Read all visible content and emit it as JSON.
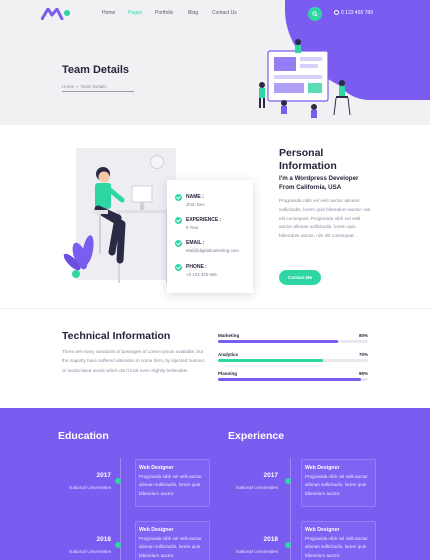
{
  "colors": {
    "accent": "#7a5cf0",
    "green": "#2ed6a4",
    "dark": "#23253a"
  },
  "nav": {
    "items": [
      "Home",
      "Pages",
      "Portfolio",
      "Blog",
      "Contact Us"
    ],
    "active": "Pages"
  },
  "header": {
    "phone": "0 123 456 789",
    "search_icon": "search-icon",
    "logo_icon": "logo-icon"
  },
  "hero": {
    "title": "Team Details",
    "breadcrumb": {
      "home": "Home",
      "current": "Team Details"
    }
  },
  "personal": {
    "title_line1": "Personal",
    "title_line2": "Information",
    "subtitle_line1": "I'm a Wordpress Developer",
    "subtitle_line2": "From California, USA",
    "text": "Progravida nibh vel velit auctor alinean sollicitudin, lorem quis bibendum auctor. nisi elit consequat. Progravida nibh vel velit auctor alinean sollicitudin, lorem quis bibendum auctor, nisi elit consequat.",
    "button": "Contact Me",
    "card": [
      {
        "label": "NAME :",
        "value": "Jhon Deo"
      },
      {
        "label": "EXPERIENCE :",
        "value": "8 Year"
      },
      {
        "label": "EMAIL :",
        "value": "Mail@digitalmarketing.com"
      },
      {
        "label": "PHONE :",
        "value": "+0 123 345 666"
      }
    ]
  },
  "technical": {
    "title": "Technical Information",
    "text": "There are many variations of passages of Lorem Ipsum available, but the majority have suffered alteration in some form, by injected humour, or randomised words which don't look even slightly believable.",
    "skills": [
      {
        "name": "Marketing",
        "percent": "80%",
        "value": 0.8,
        "color": "#7a5cf0"
      },
      {
        "name": "Analytics",
        "percent": "70%",
        "value": 0.7,
        "color": "#2ed6a4"
      },
      {
        "name": "Planning",
        "percent": "95%",
        "value": 0.95,
        "color": "#7a5cf0"
      }
    ]
  },
  "timeline": {
    "education": {
      "heading": "Education",
      "items": [
        {
          "year": "2017",
          "org": "National Universities",
          "title": "Web Designer",
          "text": "Progravida nibh vel velit auctor alinean sollicitudin, lorem quis bibendum auctor."
        },
        {
          "year": "2018",
          "org": "National Universities",
          "title": "Web Designer",
          "text": "Progravida nibh vel velit auctor alinean sollicitudin, lorem quis bibendum auctor."
        }
      ]
    },
    "experience": {
      "heading": "Experience",
      "items": [
        {
          "year": "2017",
          "org": "National Universities",
          "title": "Web Designer",
          "text": "Progravida nibh vel velit auctor alinean sollicitudin, lorem quis bibendum auctor."
        },
        {
          "year": "2018",
          "org": "National Universities",
          "title": "Web Designer",
          "text": "Progravida nibh vel velit auctor alinean sollicitudin, lorem quis bibendum auctor."
        }
      ]
    }
  }
}
